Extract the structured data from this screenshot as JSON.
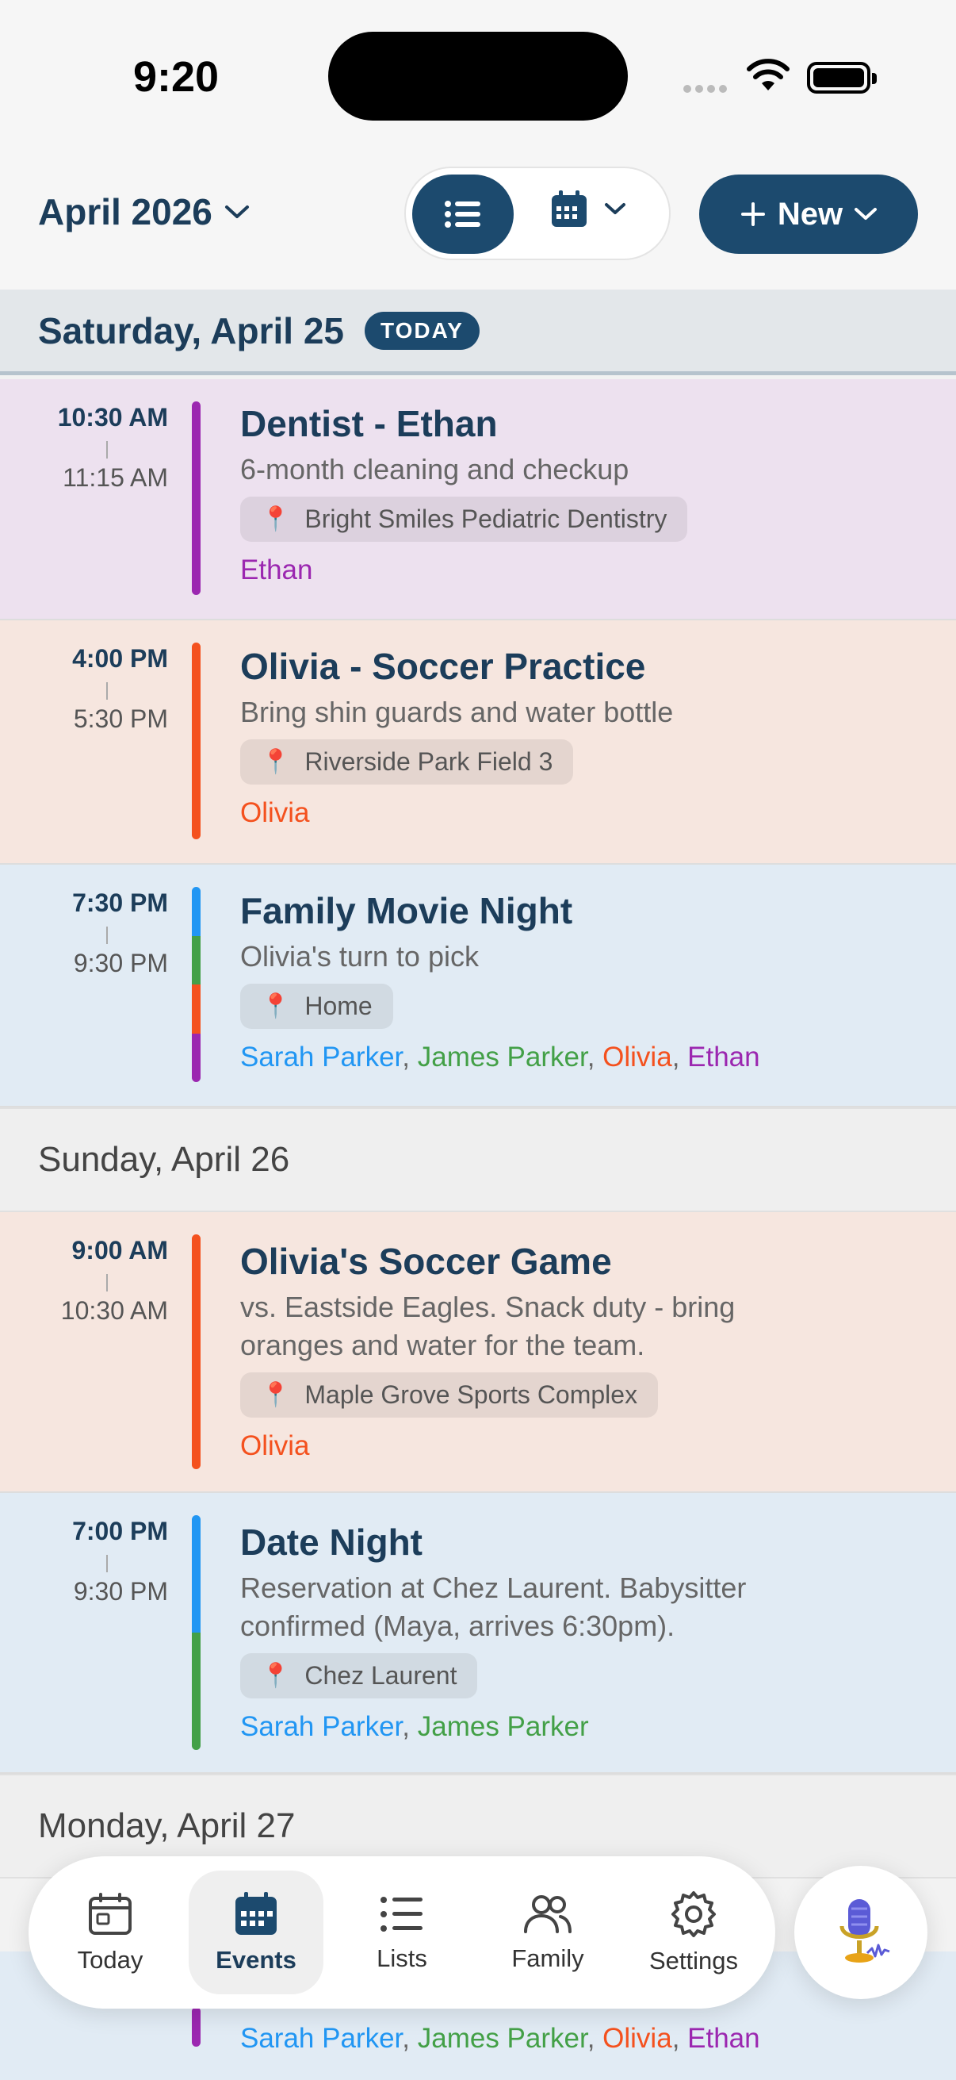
{
  "status": {
    "time": "9:20"
  },
  "header": {
    "month_label": "April 2026",
    "new_label": "New"
  },
  "days": [
    {
      "title": "Saturday, April 25",
      "badge": "TODAY"
    },
    {
      "title": "Sunday, April 26"
    },
    {
      "title": "Monday, April 27"
    }
  ],
  "events": [
    {
      "start": "10:30 AM",
      "end": "11:15 AM",
      "title": "Dentist - Ethan",
      "desc": "6-month cleaning and checkup",
      "location": "Bright Smiles Pediatric Dentistry",
      "people": [
        "Ethan"
      ]
    },
    {
      "start": "4:00 PM",
      "end": "5:30 PM",
      "title": "Olivia - Soccer Practice",
      "desc": "Bring shin guards and water bottle",
      "location": "Riverside Park Field 3",
      "people": [
        "Olivia"
      ]
    },
    {
      "start": "7:30 PM",
      "end": "9:30 PM",
      "title": "Family Movie Night",
      "desc": "Olivia's turn to pick",
      "location": "Home",
      "people": [
        "Sarah Parker",
        "James Parker",
        "Olivia",
        "Ethan"
      ]
    },
    {
      "start": "9:00 AM",
      "end": "10:30 AM",
      "title": "Olivia's Soccer Game",
      "desc": "vs. Eastside Eagles. Snack duty - bring oranges and water for the team.",
      "location": "Maple Grove Sports Complex",
      "people": [
        "Olivia"
      ]
    },
    {
      "start": "7:00 PM",
      "end": "9:30 PM",
      "title": "Date Night",
      "desc": "Reservation at Chez Laurent. Babysitter confirmed (Maya, arrives 6:30pm).",
      "location": "Chez Laurent",
      "people": [
        "Sarah Parker",
        "James Parker"
      ]
    }
  ],
  "peek_people": [
    "Sarah Parker",
    "James Parker",
    "Olivia",
    "Ethan"
  ],
  "colors": {
    "sarah": "#2196f3",
    "james": "#43a047",
    "olivia": "#f4511e",
    "ethan": "#9b27b0",
    "primary": "#1c4a6e"
  },
  "nav": [
    {
      "label": "Today",
      "icon": "calendar-today-icon"
    },
    {
      "label": "Events",
      "icon": "calendar-grid-icon",
      "active": true
    },
    {
      "label": "Lists",
      "icon": "list-icon"
    },
    {
      "label": "Family",
      "icon": "people-icon"
    },
    {
      "label": "Settings",
      "icon": "gear-icon"
    }
  ],
  "icons": {
    "voice": "microphone-icon",
    "location": "pin-icon"
  }
}
